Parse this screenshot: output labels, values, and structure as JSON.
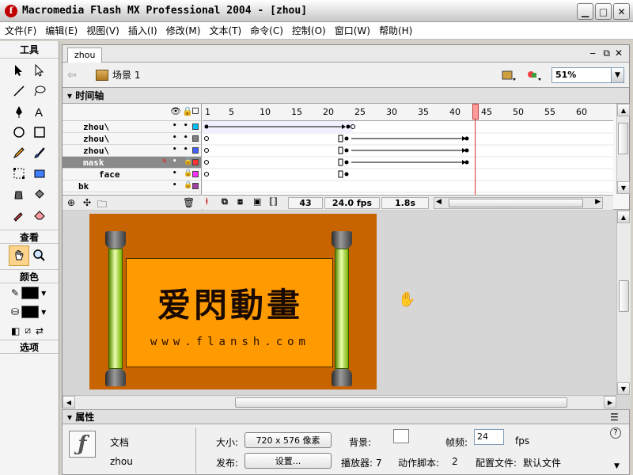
{
  "window": {
    "title": "Macromedia Flash MX Professional 2004 - [zhou]",
    "icon_letter": "f"
  },
  "menu": [
    "文件(F)",
    "编辑(E)",
    "视图(V)",
    "插入(I)",
    "修改(M)",
    "文本(T)",
    "命令(C)",
    "控制(O)",
    "窗口(W)",
    "帮助(H)"
  ],
  "tools": {
    "title": "工具",
    "view_label": "查看",
    "colors_label": "颜色",
    "options_label": "选项"
  },
  "document": {
    "tab": "zhou",
    "scene": "场景 1",
    "zoom": "51%"
  },
  "timeline": {
    "title": "时间轴",
    "ruler": [
      "1",
      "5",
      "10",
      "15",
      "20",
      "25",
      "30",
      "35",
      "40",
      "45",
      "50",
      "55",
      "60"
    ],
    "layers": [
      {
        "name": "zhou\\",
        "color": "#00c0ff"
      },
      {
        "name": "zhou\\",
        "color": "#808080"
      },
      {
        "name": "zhou\\",
        "color": "#4060ff"
      },
      {
        "name": "mask",
        "color": "#ff3030",
        "selected": true
      },
      {
        "name": "face",
        "color": "#ff30ff"
      },
      {
        "name": "bk",
        "color": "#a040a0"
      }
    ],
    "current_frame": "43",
    "fps": "24.0 fps",
    "elapsed": "1.8s"
  },
  "stage": {
    "title_text": "爱閃動畫",
    "url_text": "www.flansh.com",
    "bg_color": "#c86400",
    "paper_color": "#ff9a00"
  },
  "properties": {
    "title": "属性",
    "doc_type": "文档",
    "doc_name": "zhou",
    "size_label": "大小:",
    "size_value": "720 x 576 像素",
    "publish_label": "发布:",
    "settings_button": "设置...",
    "background_label": "背景:",
    "framerate_label": "帧频:",
    "framerate_value": "24",
    "fps_unit": "fps",
    "player_label": "播放器: 7",
    "actionscript_label": "动作脚本:",
    "actionscript_value": "2",
    "profile_label": "配置文件:",
    "profile_value": "默认文件"
  }
}
